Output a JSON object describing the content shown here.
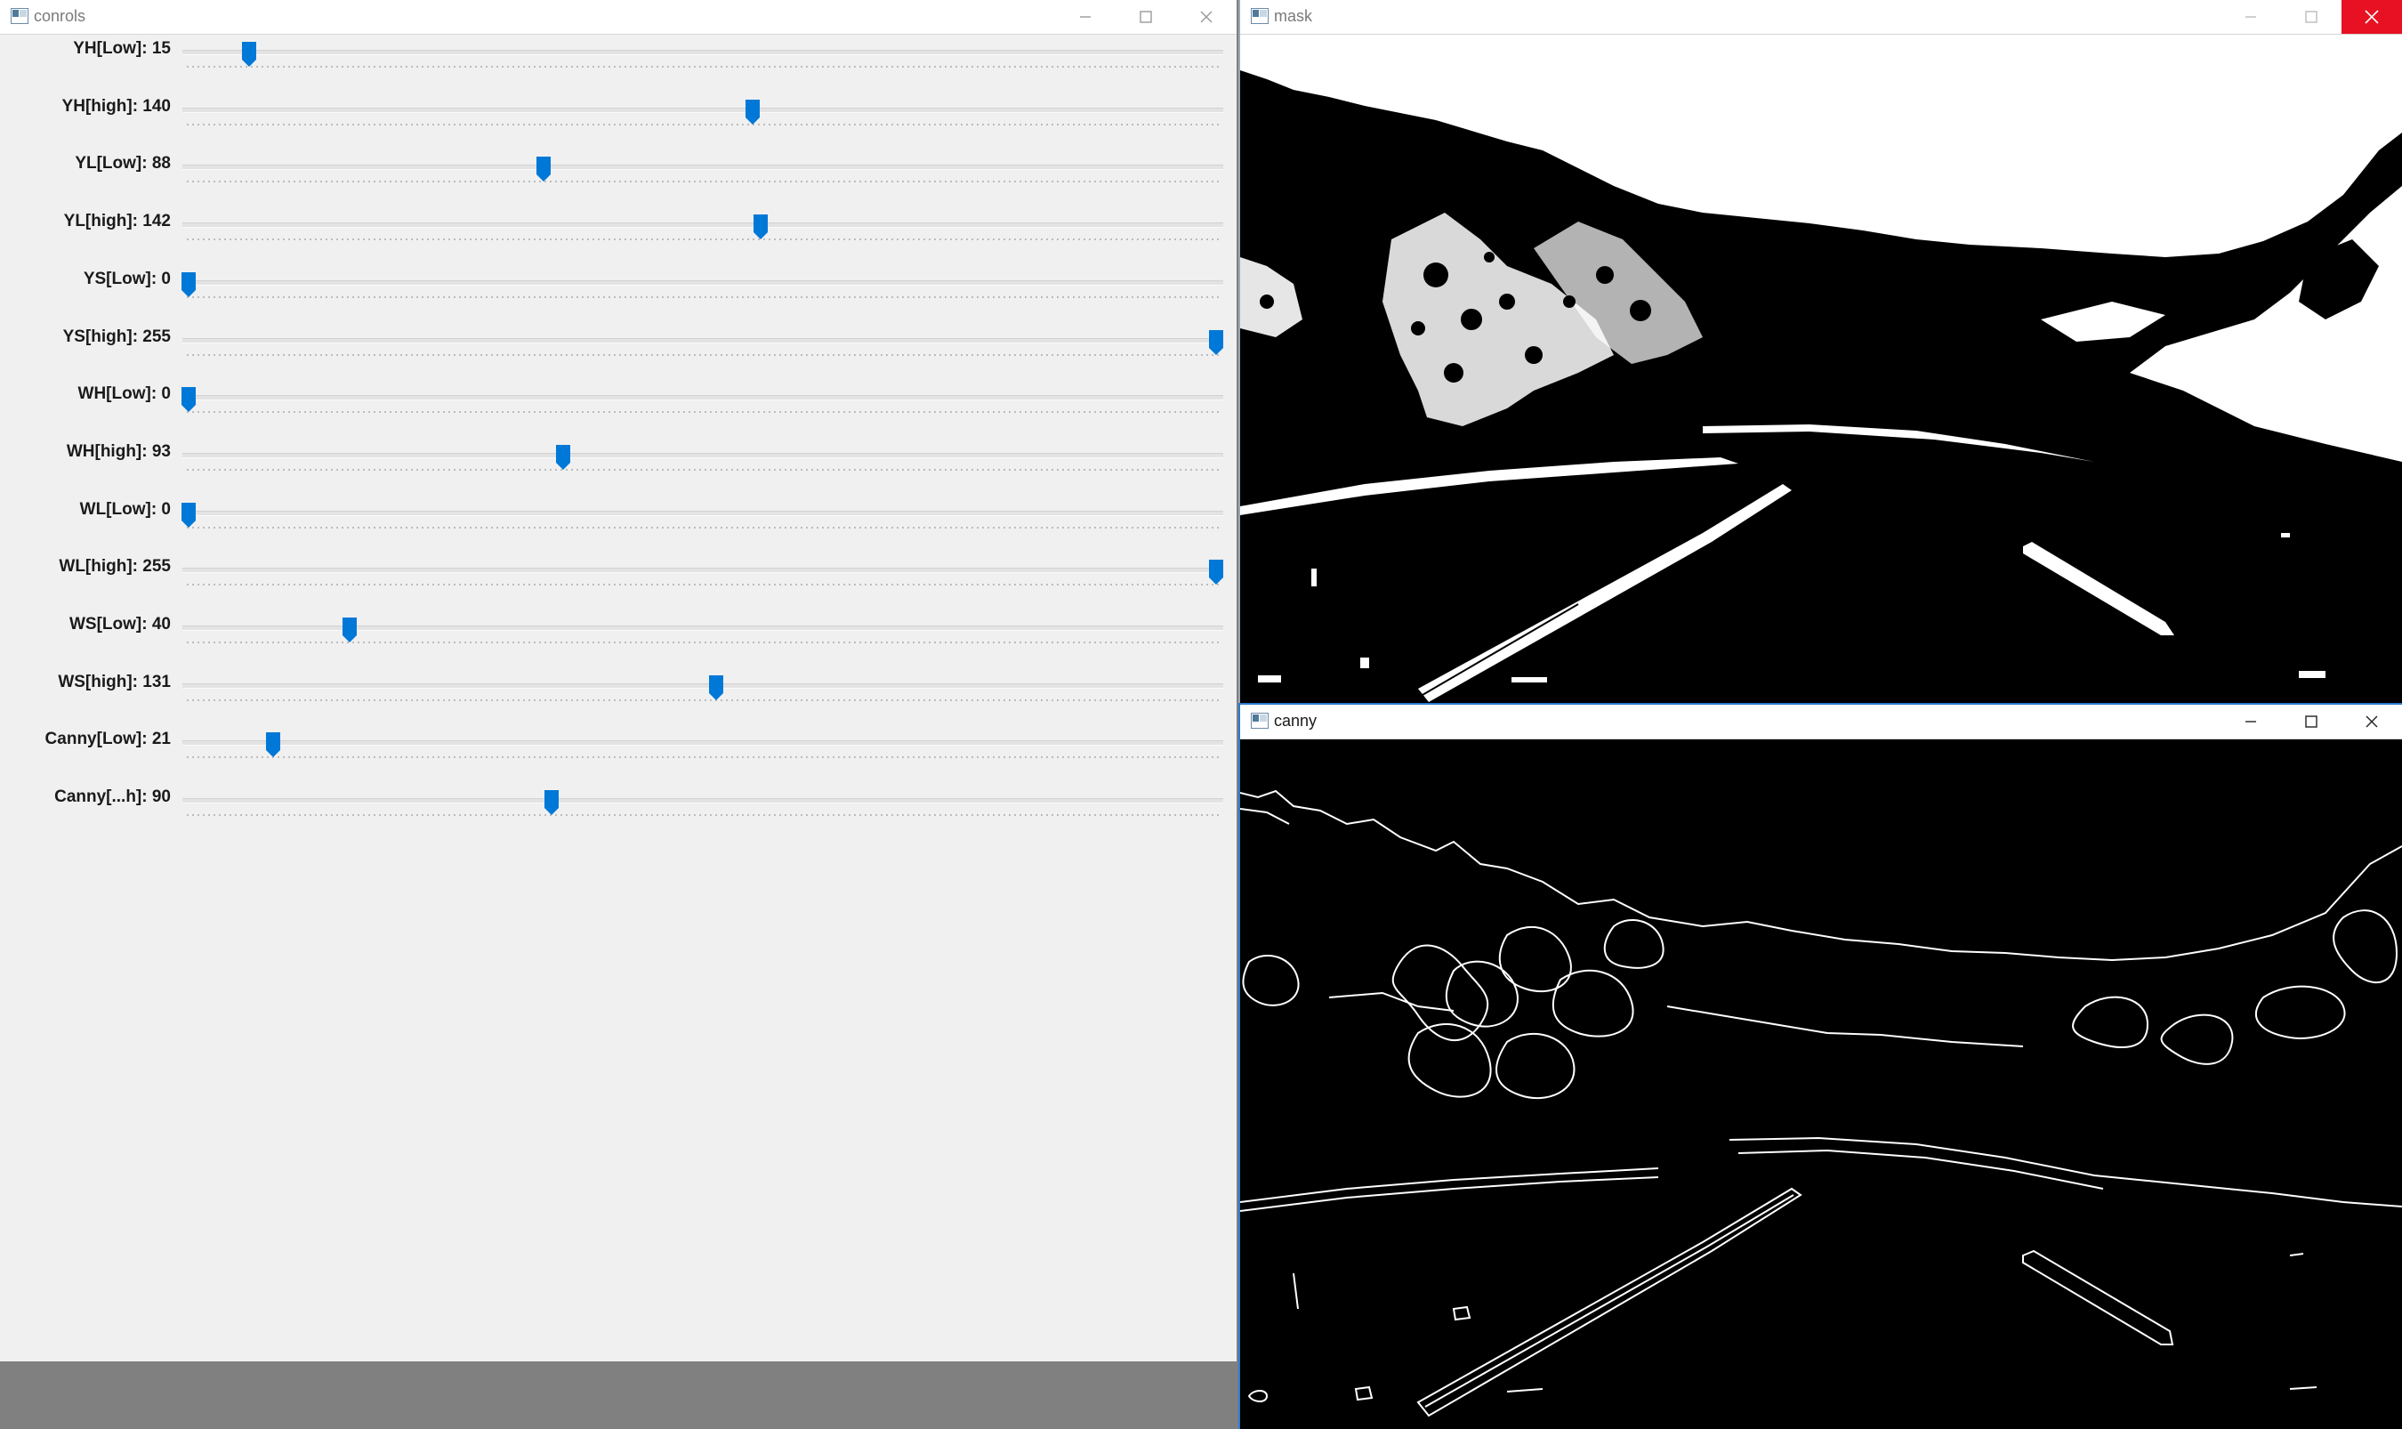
{
  "controls_window": {
    "title": "conrols",
    "sliders": [
      {
        "label": "YH[Low]: 15",
        "value": 15,
        "max": 255
      },
      {
        "label": "YH[high]: 140",
        "value": 140,
        "max": 255
      },
      {
        "label": "YL[Low]: 88",
        "value": 88,
        "max": 255
      },
      {
        "label": "YL[high]: 142",
        "value": 142,
        "max": 255
      },
      {
        "label": "YS[Low]: 0",
        "value": 0,
        "max": 255
      },
      {
        "label": "YS[high]: 255",
        "value": 255,
        "max": 255
      },
      {
        "label": "WH[Low]: 0",
        "value": 0,
        "max": 255
      },
      {
        "label": "WH[high]: 93",
        "value": 93,
        "max": 255
      },
      {
        "label": "WL[Low]: 0",
        "value": 0,
        "max": 255
      },
      {
        "label": "WL[high]: 255",
        "value": 255,
        "max": 255
      },
      {
        "label": "WS[Low]: 40",
        "value": 40,
        "max": 255
      },
      {
        "label": "WS[high]: 131",
        "value": 131,
        "max": 255
      },
      {
        "label": "Canny[Low]: 21",
        "value": 21,
        "max": 255
      },
      {
        "label": "Canny[...h]: 90",
        "value": 90,
        "max": 255
      }
    ]
  },
  "mask_window": {
    "title": "mask"
  },
  "canny_window": {
    "title": "canny"
  },
  "colors": {
    "thumb": "#0078d7",
    "close_hover": "#e81123",
    "panel": "#f0f0f0"
  }
}
